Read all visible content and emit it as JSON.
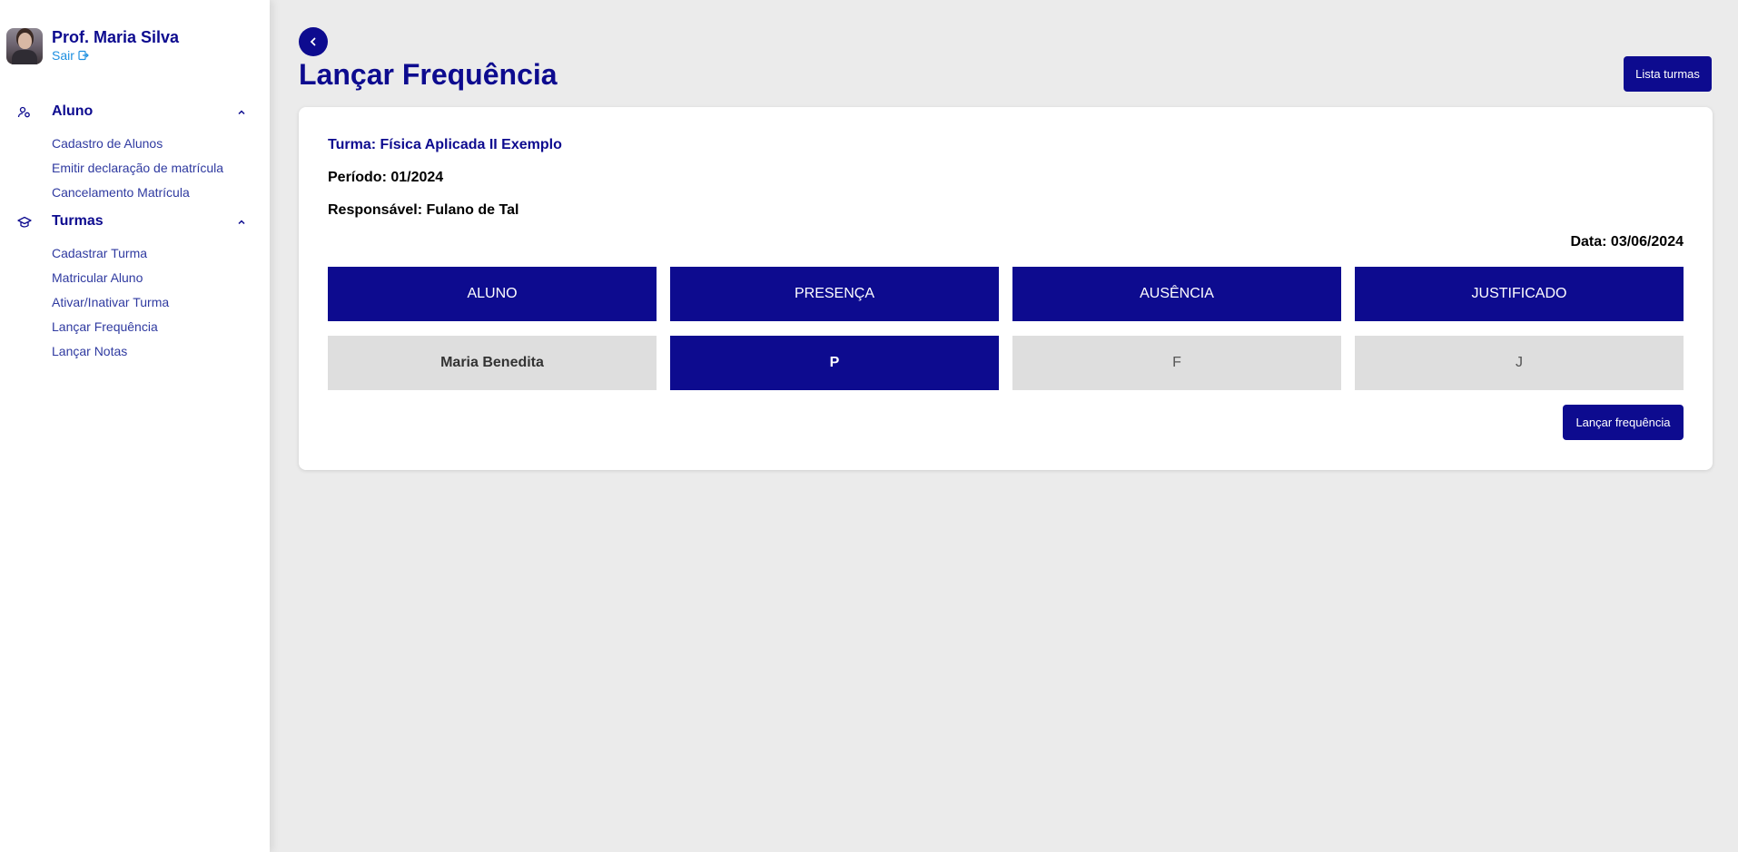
{
  "profile": {
    "name": "Prof. Maria Silva",
    "logout_label": "Sair"
  },
  "sidebar": {
    "sections": [
      {
        "title": "Aluno",
        "icon": "students-icon",
        "items": [
          "Cadastro de Alunos",
          "Emitir declaração de matrícula",
          "Cancelamento Matrícula"
        ]
      },
      {
        "title": "Turmas",
        "icon": "graduation-cap-icon",
        "items": [
          "Cadastrar Turma",
          "Matricular Aluno",
          "Ativar/Inativar Turma",
          "Lançar Frequência",
          "Lançar Notas"
        ]
      }
    ]
  },
  "page": {
    "title": "Lançar Frequência",
    "list_button": "Lista turmas"
  },
  "card": {
    "turma": "Turma: Física Aplicada II Exemplo",
    "periodo": "Período: 01/2024",
    "responsavel": "Responsável: Fulano de Tal",
    "data": "Data: 03/06/2024",
    "columns": [
      "ALUNO",
      "PRESENÇA",
      "AUSÊNCIA",
      "JUSTIFICADO"
    ],
    "rows": [
      {
        "aluno": "Maria Benedita",
        "presenca": "P",
        "ausencia": "F",
        "justificado": "J",
        "selected": "presenca"
      }
    ],
    "submit_label": "Lançar frequência"
  },
  "colors": {
    "primary": "#0d0b8f",
    "link": "#1e8fe0",
    "cell_bg": "#dedede",
    "page_bg": "#ebebeb"
  }
}
